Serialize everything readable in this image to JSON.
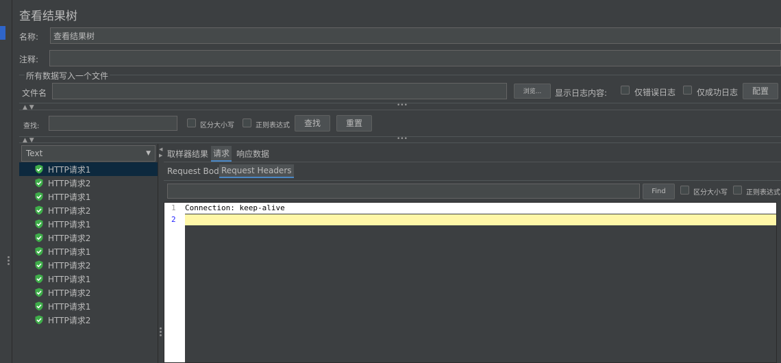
{
  "title": "查看结果树",
  "name": {
    "label": "名称:",
    "value": "查看结果树"
  },
  "comment": {
    "label": "注释:",
    "value": ""
  },
  "file_section": {
    "legend": "所有数据写入一个文件",
    "file_label": "文件名",
    "file_value": "",
    "browse_label": "浏览...",
    "log_label": "显示日志内容:",
    "errors_only": "仅错误日志",
    "success_only": "仅成功日志",
    "configure": "配置"
  },
  "search": {
    "label": "查找:",
    "value": "",
    "case_sensitive": "区分大小写",
    "regex": "正则表达式",
    "find_button": "查找",
    "reset_button": "重置"
  },
  "renderer": {
    "selected": "Text"
  },
  "tree_items": [
    "HTTP请求1",
    "HTTP请求2",
    "HTTP请求1",
    "HTTP请求2",
    "HTTP请求1",
    "HTTP请求2",
    "HTTP请求1",
    "HTTP请求2",
    "HTTP请求1",
    "HTTP请求2",
    "HTTP请求1",
    "HTTP请求2"
  ],
  "tabs": {
    "sampler_result": "取样器结果",
    "request": "请求",
    "response": "响应数据"
  },
  "subtabs": {
    "body": "Request Body",
    "headers": "Request Headers"
  },
  "inner_search": {
    "value": "",
    "find_button": "Find",
    "case_sensitive": "区分大小写",
    "regex": "正则表达式"
  },
  "editor": {
    "line_numbers": [
      "1",
      "2"
    ],
    "lines": [
      "Connection: keep-alive",
      ""
    ]
  },
  "colors": {
    "accent": "#4a88c7",
    "success_icon": "#3fae4a",
    "highlight_line": "#fff7a8"
  }
}
